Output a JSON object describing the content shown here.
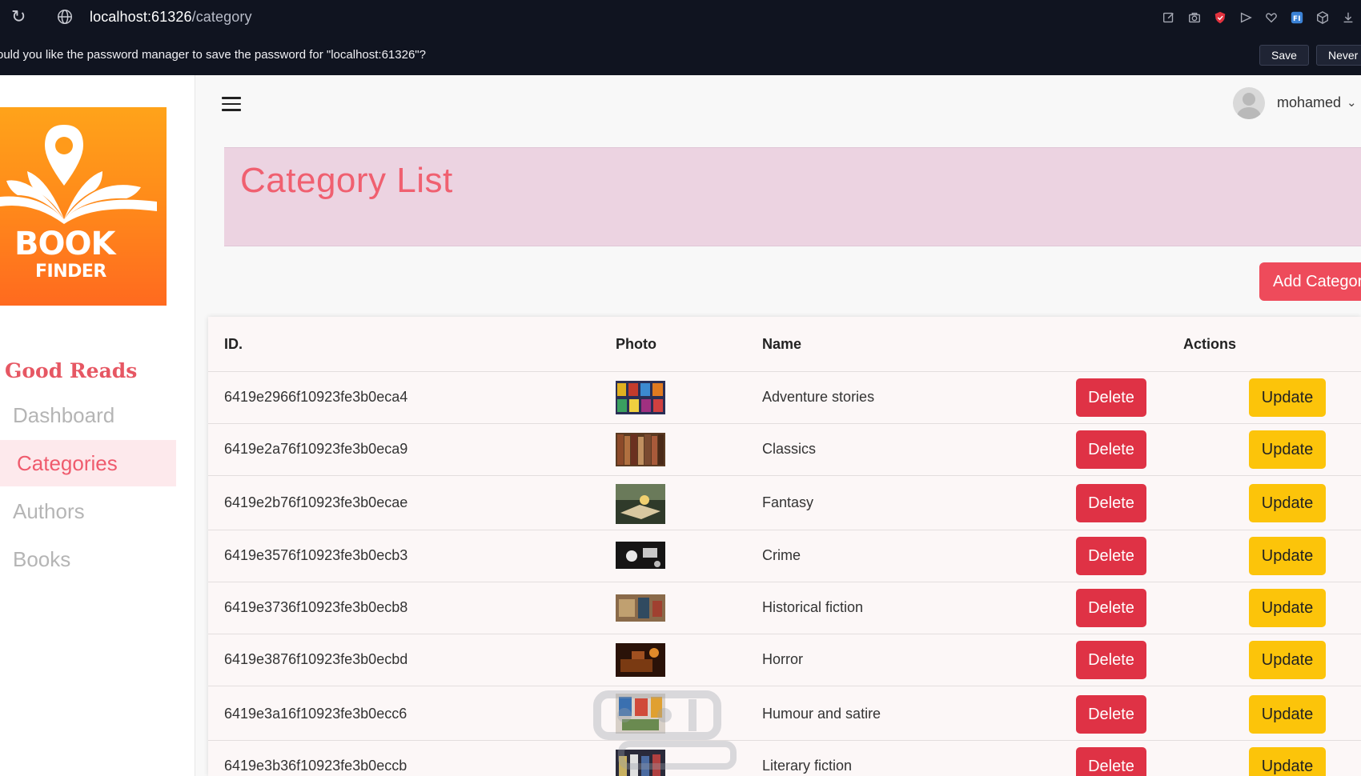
{
  "browser": {
    "url_host": "localhost:61326",
    "url_path": "/category",
    "extension_icons": [
      "edit-icon",
      "camera-icon",
      "shield-icon",
      "send-icon",
      "heart-icon",
      "extension-fi-icon",
      "cube-icon",
      "download-icon"
    ]
  },
  "password_bar": {
    "message": "ould you like the password manager to save the password for \"localhost:61326\"?",
    "save_label": "Save",
    "never_label": "Never"
  },
  "sidebar": {
    "logo_line1": "BOOK",
    "logo_line2": "FINDER",
    "brand": "Good Reads",
    "items": [
      {
        "label": "Dashboard",
        "active": false
      },
      {
        "label": "Categories",
        "active": true
      },
      {
        "label": "Authors",
        "active": false
      },
      {
        "label": "Books",
        "active": false
      }
    ]
  },
  "header": {
    "user_name": "mohamed",
    "chevron": "⌄"
  },
  "page": {
    "title": "Category List",
    "add_button_label": "Add Category"
  },
  "table": {
    "headers": {
      "id": "ID.",
      "photo": "Photo",
      "name": "Name",
      "actions": "Actions"
    },
    "delete_label": "Delete",
    "update_label": "Update",
    "rows": [
      {
        "id": "6419e2966f10923fe3b0eca4",
        "name": "Adventure stories"
      },
      {
        "id": "6419e2a76f10923fe3b0eca9",
        "name": "Classics"
      },
      {
        "id": "6419e2b76f10923fe3b0ecae",
        "name": "Fantasy"
      },
      {
        "id": "6419e3576f10923fe3b0ecb3",
        "name": "Crime"
      },
      {
        "id": "6419e3736f10923fe3b0ecb8",
        "name": "Historical fiction"
      },
      {
        "id": "6419e3876f10923fe3b0ecbd",
        "name": "Horror"
      },
      {
        "id": "6419e3a16f10923fe3b0ecc6",
        "name": "Humour and satire"
      },
      {
        "id": "6419e3b36f10923fe3b0eccb",
        "name": "Literary fiction"
      }
    ]
  },
  "colors": {
    "accent": "#ef5b6d",
    "delete": "#df3245",
    "update": "#fcc40a",
    "title_bg": "#ecd3e1"
  }
}
